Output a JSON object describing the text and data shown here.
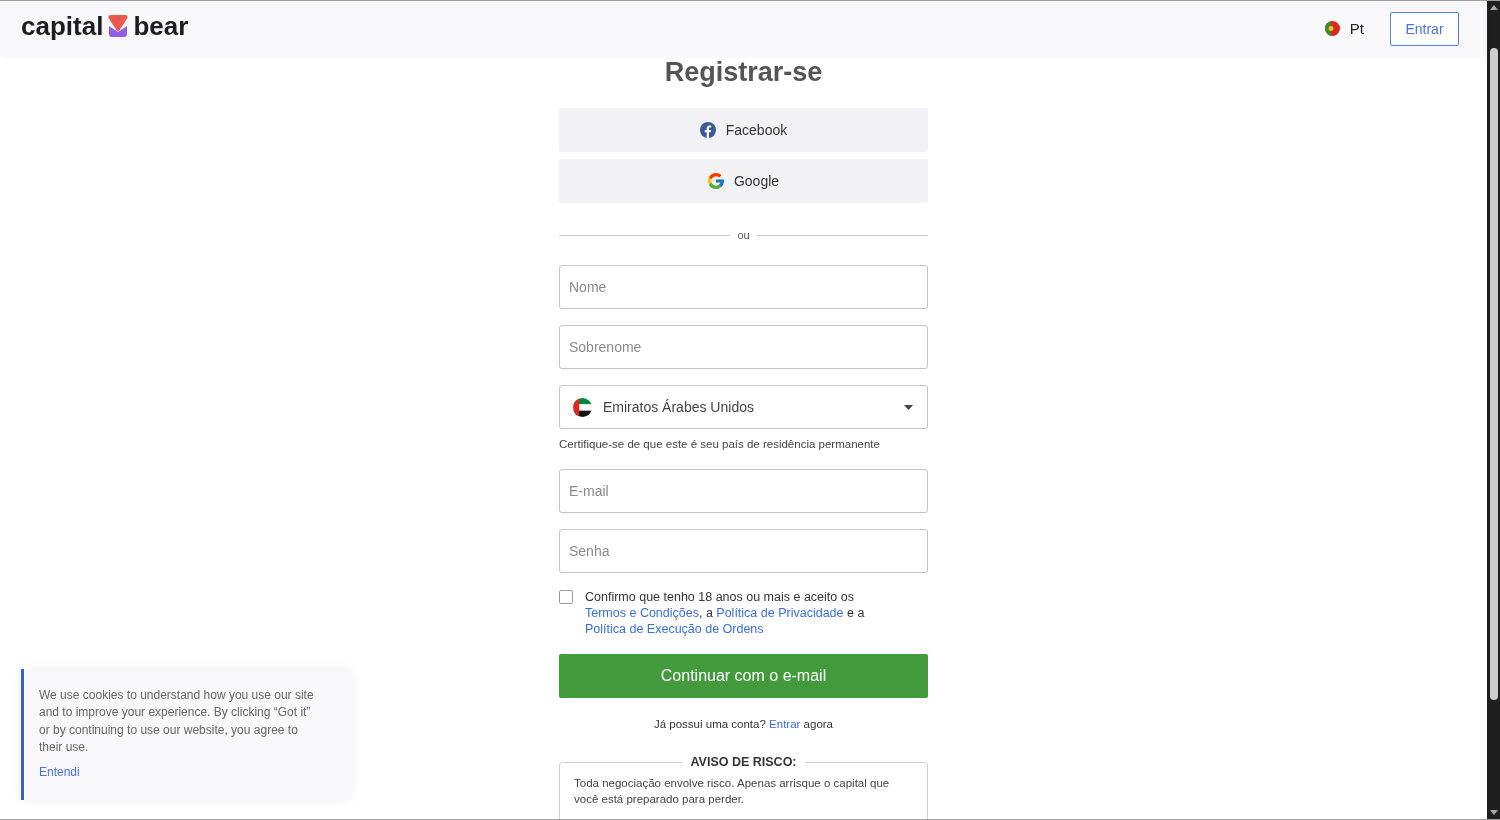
{
  "header": {
    "logo": [
      "capital",
      "bear"
    ],
    "language": {
      "label": "Pt"
    },
    "login_button": "Entrar"
  },
  "title": "Registrar-se",
  "social_buttons": [
    {
      "kind": "facebook",
      "label": "Facebook"
    },
    {
      "kind": "google",
      "label": "Google"
    }
  ],
  "divider": "ou",
  "fields": [
    {
      "kind": "text",
      "placeholder": "Nome"
    },
    {
      "kind": "text",
      "placeholder": "Sobrenome"
    },
    {
      "kind": "select",
      "value": "Emiratos Árabes Unidos",
      "hint": "Certifique-se de que este é seu país de residência permanente"
    },
    {
      "kind": "email",
      "placeholder": "E-mail"
    },
    {
      "kind": "password",
      "placeholder": "Senha"
    }
  ],
  "consent": {
    "checked": false,
    "segments": [
      {
        "kind": "text",
        "text": "Confirmo que tenho 18 anos ou mais e aceito os "
      },
      {
        "kind": "link",
        "text": "Termos e Condições"
      },
      {
        "kind": "text",
        "text": ", a "
      },
      {
        "kind": "link",
        "text": "Política de Privacidade"
      },
      {
        "kind": "text",
        "text": " e a "
      },
      {
        "kind": "link",
        "text": "Política de Execução de Ordens"
      }
    ]
  },
  "submit_button": "Continuar com o e-mail",
  "login_prompt": [
    {
      "kind": "text",
      "text": "Já possui uma conta? "
    },
    {
      "kind": "link",
      "text": "Entrar"
    },
    {
      "kind": "text",
      "text": " agora"
    }
  ],
  "risk_warning": {
    "title": "AVISO DE RISCO:",
    "text": "Toda negociação envolve risco. Apenas arrisque o capital que você está preparado para perder."
  },
  "cookie_banner": {
    "text": "We use cookies to understand how you use our site and to improve your experience. By clicking “Got it” or by continuing to use our website, you agree to their use.",
    "button": "Entendi"
  }
}
